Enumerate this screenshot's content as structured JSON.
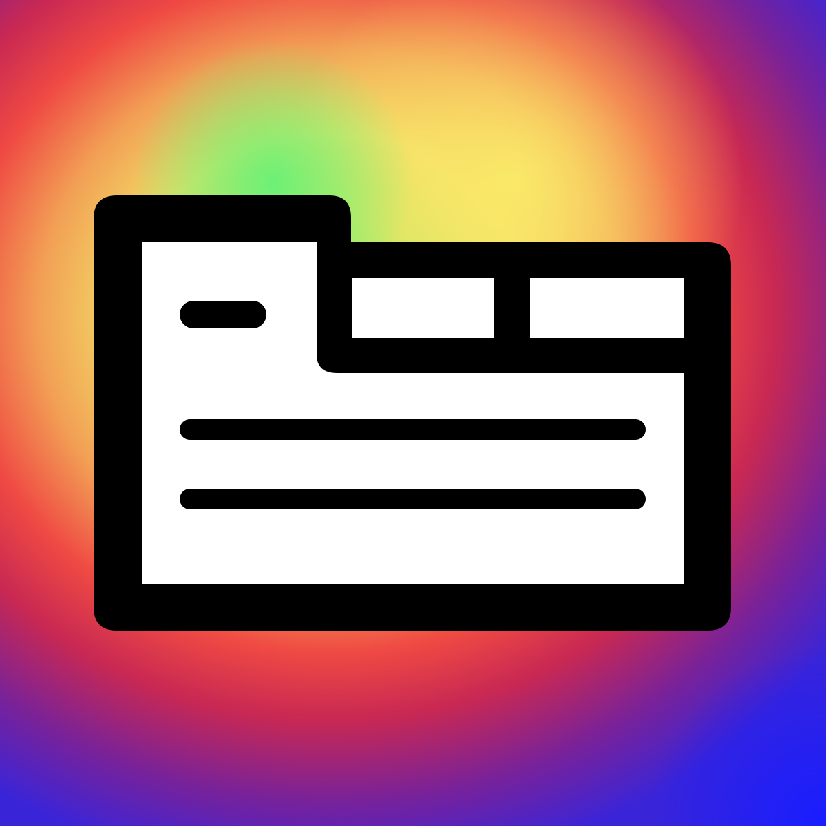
{
  "artwork": {
    "icon": "document-folder-icon",
    "colors": {
      "outline": "#000000",
      "fill": "#ffffff",
      "background_center": "#5df27a",
      "background_warm": "#f3df66",
      "background_mid": "#ef4a43",
      "background_edge": "#3a24d8"
    }
  }
}
